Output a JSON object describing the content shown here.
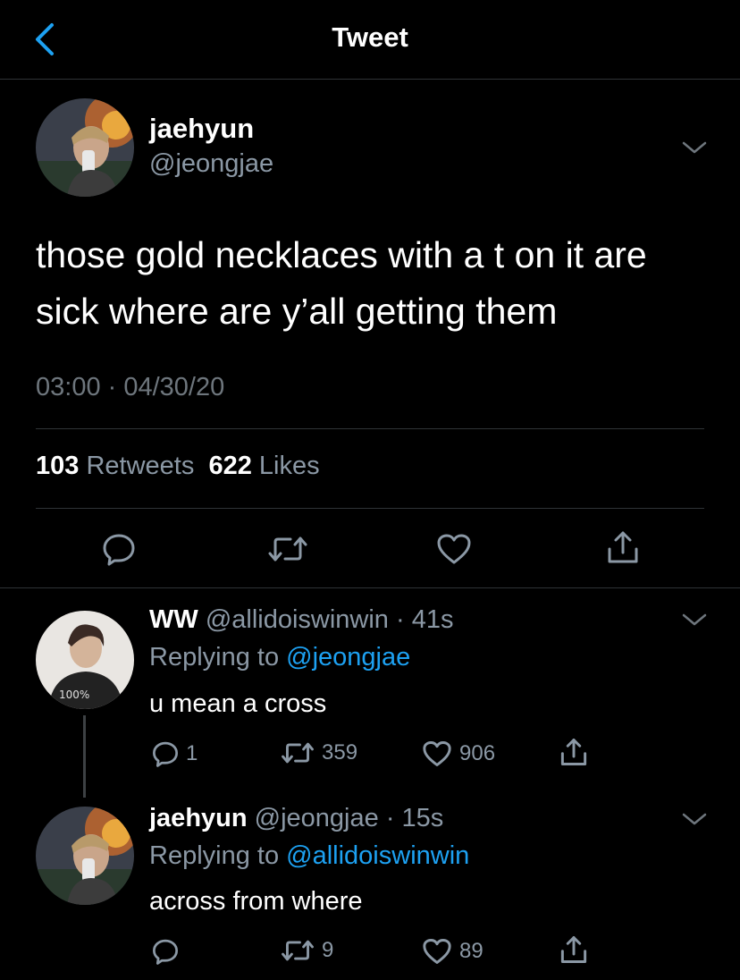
{
  "header": {
    "title": "Tweet"
  },
  "main_tweet": {
    "name": "jaehyun",
    "handle": "@jeongjae",
    "text": "those gold necklaces with a t on it are sick where are y’all getting them",
    "timestamp": "03:00 · 04/30/20",
    "retweets_count": "103",
    "retweets_label": "Retweets",
    "likes_count": "622",
    "likes_label": "Likes"
  },
  "replies": [
    {
      "name": "WW",
      "handle": "@allidoiswinwin",
      "time": "41s",
      "replying_prefix": "Replying to",
      "replying_to": "@jeongjae",
      "text": "u mean a cross",
      "reply_count": "1",
      "retweet_count": "359",
      "like_count": "906"
    },
    {
      "name": "jaehyun",
      "handle": "@jeongjae",
      "time": "15s",
      "replying_prefix": "Replying to",
      "replying_to": "@allidoiswinwin",
      "text": "across from where",
      "reply_count": "",
      "retweet_count": "9",
      "like_count": "89"
    }
  ],
  "colors": {
    "accent": "#1da1f2",
    "secondary_text": "#8b98a5",
    "background": "#000000",
    "divider": "#2f3336"
  }
}
